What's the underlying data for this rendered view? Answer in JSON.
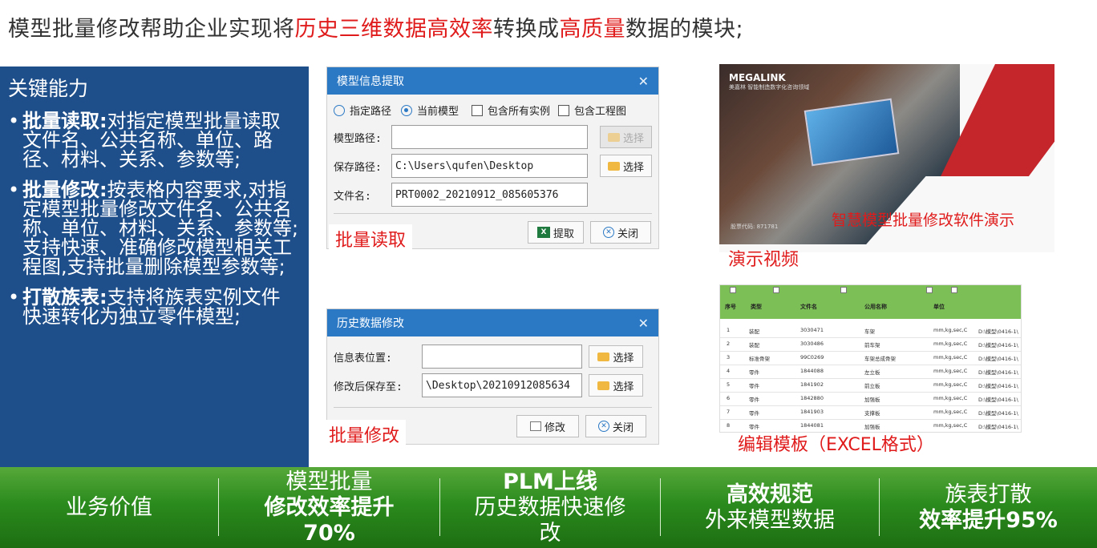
{
  "headline": {
    "seg1": "模型批量修改帮助企业实现将",
    "seg2": "历史三维数据",
    "seg3": "高效率",
    "seg4": "转换成",
    "seg5": "高质量",
    "seg6": "数据的模块;"
  },
  "left_panel": {
    "title": "关键能力",
    "items": [
      {
        "head": "批量读取:",
        "text": "对指定模型批量读取文件名、公共名称、单位、路径、材料、关系、参数等;"
      },
      {
        "head": "批量修改:",
        "text": "按表格内容要求,对指定模型批量修改文件名、公共名称、单位、材料、关系、参数等;支持快速、准确修改模型相关工程图,支持批量删除模型参数等;"
      },
      {
        "head": "打散族表:",
        "text": "支持将族表实例文件快速转化为独立零件模型;"
      }
    ]
  },
  "dialog1": {
    "title": "模型信息提取",
    "radio1": "指定路径",
    "radio2": "当前模型",
    "check1": "包含所有实例",
    "check2": "包含工程图",
    "model_path_label": "模型路径:",
    "model_path_value": "",
    "save_path_label": "保存路径:",
    "save_path_value": "C:\\Users\\qufen\\Desktop",
    "filename_label": "文件名:",
    "filename_value": "PRT0002_20210912_085605376",
    "select_label": "选择",
    "extract_label": "提取",
    "close_label": "关闭",
    "caption": "批量读取"
  },
  "dialog2": {
    "title": "历史数据修改",
    "info_label": "信息表位置:",
    "info_value": "",
    "save_label": "修改后保存至:",
    "save_value": "\\Desktop\\20210912085634",
    "select_label": "选择",
    "modify_label": "修改",
    "close_label": "关闭",
    "caption": "批量修改"
  },
  "video": {
    "logo": "MEGALINK",
    "sub": "美嘉林 智能制造数字化咨询领域",
    "code": "股票代码: 871781",
    "title": "智慧模型批量修改软件演示",
    "caption": "演示视频"
  },
  "excel": {
    "headers": [
      "序号",
      "类型",
      "文件名",
      "公用名称",
      "单位"
    ],
    "rows": [
      [
        "1",
        "装配",
        "3030471",
        "车架",
        "mm,kg,sec,C",
        "D:\\模型\\0416-1\\"
      ],
      [
        "2",
        "装配",
        "3030486",
        "前车架",
        "mm,kg,sec,C",
        "D:\\模型\\0416-1\\"
      ],
      [
        "3",
        "标准骨架",
        "99C0269",
        "车架总成骨架",
        "mm,kg,sec,C",
        "D:\\模型\\0416-1\\"
      ],
      [
        "4",
        "零件",
        "1844088",
        "左立板",
        "mm,kg,sec,C",
        "D:\\模型\\0416-1\\"
      ],
      [
        "5",
        "零件",
        "1841902",
        "前立板",
        "mm,kg,sec,C",
        "D:\\模型\\0416-1\\"
      ],
      [
        "6",
        "零件",
        "1842880",
        "加强板",
        "mm,kg,sec,C",
        "D:\\模型\\0416-1\\"
      ],
      [
        "7",
        "零件",
        "1841903",
        "支撑板",
        "mm,kg,sec,C",
        "D:\\模型\\0416-1\\"
      ],
      [
        "8",
        "零件",
        "1844081",
        "加强板",
        "mm,kg,sec,C",
        "D:\\模型\\0416-1\\"
      ]
    ],
    "caption": "编辑模板（EXCEL格式）"
  },
  "bottom": {
    "label": "业务价值",
    "c1_l1": "模型批量",
    "c1_l2": "修改效率提升",
    "c1_l3": "70%",
    "c2_l1": "PLM上线",
    "c2_l2": "历史数据快速修",
    "c2_l3": "改",
    "c3_l1": "高效规范",
    "c3_l2": "外来模型数据",
    "c4_l1": "族表打散",
    "c4_l2": "效率提升95%"
  }
}
